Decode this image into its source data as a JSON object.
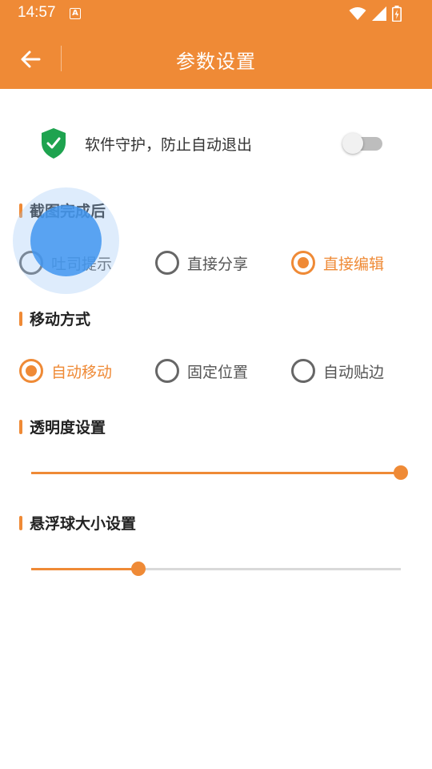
{
  "status_bar": {
    "time": "14:57",
    "notification_icon": "text-a-icon",
    "notification_glyph": "A",
    "icons": [
      "wifi-icon",
      "signal-icon",
      "battery-charging-icon"
    ]
  },
  "app_bar": {
    "title": "参数设置",
    "back_icon": "arrow-left-icon"
  },
  "protect": {
    "label": "软件守护，防止自动退出",
    "icon": "shield-check-icon",
    "enabled": false
  },
  "sections": {
    "screenshot_after": {
      "title": "截图完成后",
      "options": [
        "吐司提示",
        "直接分享",
        "直接编辑"
      ],
      "selected": "直接编辑"
    },
    "move_mode": {
      "title": "移动方式",
      "options": [
        "自动移动",
        "固定位置",
        "自动贴边"
      ],
      "selected": "自动移动"
    },
    "opacity": {
      "title": "透明度设置",
      "value": 1.0
    },
    "ball_size": {
      "title": "悬浮球大小设置",
      "value": 0.29
    }
  },
  "colors": {
    "accent": "#EF8A36",
    "text": "#333333",
    "radio_unchecked": "#666666"
  }
}
